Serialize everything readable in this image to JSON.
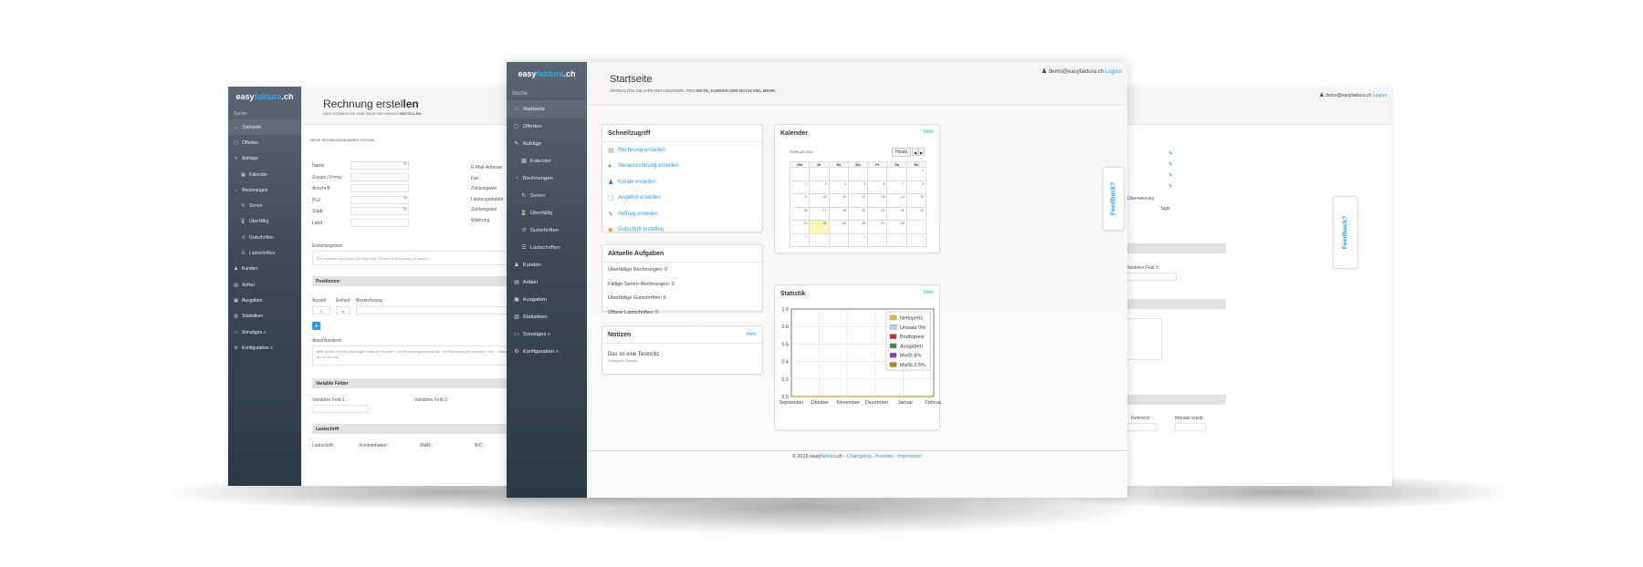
{
  "brand": {
    "part1": "easy",
    "part2": "faktura",
    "part3": ".ch"
  },
  "nav": {
    "search": "Suche",
    "items": [
      {
        "label": "Startseite",
        "icon": "home-icon",
        "glyph": "⌂",
        "sub": false
      },
      {
        "label": "Offerten",
        "icon": "document-icon",
        "glyph": "▢",
        "sub": false
      },
      {
        "label": "Aufräge",
        "icon": "edit-icon",
        "glyph": "✎",
        "sub": false
      },
      {
        "label": "Kalender",
        "icon": "calendar-icon",
        "glyph": "▦",
        "sub": true
      },
      {
        "label": "Rechnungen",
        "icon": "invoice-icon",
        "glyph": "◔",
        "sub": false
      },
      {
        "label": "Serien",
        "icon": "refresh-icon",
        "glyph": "↻",
        "sub": true
      },
      {
        "label": "Überfällig",
        "icon": "hourglass-icon",
        "glyph": "⌛",
        "sub": true
      },
      {
        "label": "Gutschriften",
        "icon": "undo-icon",
        "glyph": "↺",
        "sub": true
      },
      {
        "label": "Lastschriften",
        "icon": "list-icon",
        "glyph": "☰",
        "sub": true
      },
      {
        "label": "Kunden",
        "icon": "user-icon",
        "glyph": "♟",
        "sub": false
      },
      {
        "label": "Artikel",
        "icon": "tag-icon",
        "glyph": "▤",
        "sub": false
      },
      {
        "label": "Ausgaben",
        "icon": "money-icon",
        "glyph": "▣",
        "sub": false
      },
      {
        "label": "Statistiken",
        "icon": "chart-icon",
        "glyph": "▥",
        "sub": false
      },
      {
        "label": "Sonstiges »",
        "icon": "inbox-icon",
        "glyph": "▭",
        "sub": false
      },
      {
        "label": "Konfiguration »",
        "icon": "gear-icon",
        "glyph": "⚙",
        "sub": false
      }
    ]
  },
  "user": {
    "email": "demo@easyfaktura.ch",
    "logout": "Logout"
  },
  "feedback": "Feedback?",
  "center": {
    "title": "Startseite",
    "subtitle_pre": "VERWALTEN SIE IHRE RECHNUNGEN, PROJ",
    "subtitle_bold": "EKTE, KUNDEN UND NOCH VIEL MEHR.",
    "quick": {
      "title": "Schnellzugriff",
      "items": [
        {
          "label": "Rechnung erstellen",
          "icon": "invoice-icon",
          "glyph": "▤",
          "color": "#8a8a8a"
        },
        {
          "label": "Serienrechnung erstellen",
          "icon": "add-icon",
          "glyph": "●",
          "color": "#5cb85c"
        },
        {
          "label": "Kunde erstellen",
          "icon": "user-icon",
          "glyph": "♟",
          "color": "#2f7fc6"
        },
        {
          "label": "Angebot erstellen",
          "icon": "document-icon",
          "glyph": "▢",
          "color": "#999999"
        },
        {
          "label": "Auftrag erstellen",
          "icon": "edit-icon",
          "glyph": "✎",
          "color": "#777777"
        },
        {
          "label": "Gutschrift erstellen",
          "icon": "coins-icon",
          "glyph": "◆",
          "color": "#e0a030"
        }
      ]
    },
    "tasks": {
      "title": "Aktuelle Aufgaben",
      "items": [
        "Überfällige Rechnungen: 0",
        "Fällige Serien-Rechnungen: 0",
        "Überfällige Gutschriften: 0",
        "Offene Lastschriften: 0"
      ]
    },
    "notes": {
      "title": "Notizen",
      "more": "Mehr",
      "note": "Das ist eine Testnotiz",
      "category": "Kategorie: Default"
    },
    "calendar": {
      "title": "Kalender",
      "more": "Mehr",
      "month": "FEBRUAR 2015",
      "today": "Heute",
      "prev": "◀",
      "next": "▶",
      "days": [
        "Mo",
        "Di",
        "Mi",
        "Do",
        "Fr",
        "Sa",
        "So"
      ],
      "weeks": [
        [
          "",
          "",
          "",
          "",
          "",
          "",
          "1"
        ],
        [
          "2",
          "3",
          "4",
          "5",
          "6",
          "7",
          "8"
        ],
        [
          "9",
          "10",
          "11",
          "12",
          "13",
          "14",
          "15"
        ],
        [
          "16",
          "17",
          "18",
          "19",
          "20",
          "21",
          "22"
        ],
        [
          "23",
          "24",
          "25",
          "26",
          "27",
          "28",
          "1"
        ],
        [
          "2",
          "3",
          "4",
          "5",
          "6",
          "7",
          "8"
        ]
      ]
    },
    "stats": {
      "title": "Statistik",
      "more": "Mehr"
    },
    "footer": {
      "pre": "© 2016 easy",
      "brand": "faktura",
      "post": ".ch",
      "sep": " - ",
      "links": [
        "Changelog",
        "Kontakt",
        "Impressum"
      ]
    }
  },
  "chart_data": {
    "type": "line",
    "title": "",
    "categories": [
      "September",
      "Oktober",
      "November",
      "Dezember",
      "Januar",
      "Februar"
    ],
    "ylim": [
      0,
      1.0
    ],
    "yticks": [
      "1.0",
      "0.8",
      "0.6",
      "0.4",
      "0.2",
      "0.0"
    ],
    "grid": true,
    "legend_position": "top-right",
    "series": [
      {
        "name": "Nettopreis",
        "values": [
          0,
          0,
          0,
          0,
          0,
          0
        ],
        "color": "#e8b94a"
      },
      {
        "name": "Umsatz 0%",
        "values": [
          0,
          0,
          0,
          0,
          0,
          0
        ],
        "color": "#a9d6f5"
      },
      {
        "name": "Bruttopreis",
        "values": [
          0,
          0,
          0,
          0,
          0,
          0
        ],
        "color": "#c9302c"
      },
      {
        "name": "Ausgaben",
        "values": [
          0,
          0,
          0,
          0,
          0,
          0
        ],
        "color": "#3c8d3c"
      },
      {
        "name": "MwSt 8%",
        "values": [
          0,
          0,
          0,
          0,
          0,
          0
        ],
        "color": "#7b3fbf"
      },
      {
        "name": "MwSt 2,5%",
        "values": [
          0,
          0,
          0,
          0,
          0,
          0
        ],
        "color": "#b8860b"
      }
    ]
  },
  "left": {
    "title_pre": "Rechnung erstel",
    "title_bold": "len",
    "subtitle_pre": "HIER KÖNNEN SIE EINE NEUE RECHNUNG ",
    "subtitle_bold": "ERSTELLEN.",
    "invno": "NEUE RECHNUNGNUMMER: RE1000",
    "fields": [
      "Name",
      "Zusatz / Firma",
      "Anschrift",
      "PLZ",
      "Stadt",
      "Land"
    ],
    "fields_right": [
      "E-Mail-Adresse",
      "Fax",
      "Zahlungswei",
      "Leistungsdatum",
      "Zahlungsziel",
      "Währung"
    ],
    "intro_label": "Einleitungstext:",
    "intro_text": "Wir erlauben uns Ihnen die folgenden Posten in Rechnung zu stellen.",
    "positions": "Positionen:",
    "pos_cols": [
      "Anzahl",
      "Einheit",
      "Bezeichnung"
    ],
    "pos_vals": [
      "1",
      "x"
    ],
    "add": "+",
    "closing_label": "Abschlusstext:",
    "closing_text": "Bitte geben Sie bei Zahlungen stets die Kunden- und Rechnungsnummer an. Die Rechnung ist innerhalb von ... Vielen Dank für Ihr Vertrauen.",
    "var_title": "Variable Felder",
    "var1": "Variables Feld 1:",
    "var2": "Variables Feld 2:",
    "ls_title": "Lastschrift",
    "ls_cols": [
      "Lastschrift:",
      "Kontoinhaber:",
      "IBAN:",
      "BIC:"
    ]
  },
  "right": {
    "bank": "Überweisung",
    "days": "Tage",
    "var3": "Variables Feld 3:",
    "ref": "Referenz:",
    "mandate": "Mandat erteilt:"
  }
}
